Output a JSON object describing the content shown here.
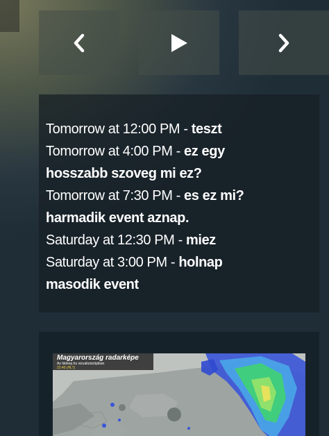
{
  "controls": {
    "prev_icon": "chevron-left-icon",
    "play_icon": "play-icon",
    "next_icon": "chevron-right-icon"
  },
  "events": [
    {
      "when": "Tomorrow at 12:00 PM",
      "separator": " - ",
      "title": "teszt"
    },
    {
      "when": "Tomorrow at 4:00 PM",
      "separator": " - ",
      "title": "ez egy hosszabb szoveg mi ez?"
    },
    {
      "when": "Tomorrow at 7:30 PM",
      "separator": " - ",
      "title": "es ez mi? harmadik event aznap."
    },
    {
      "when": "Saturday at 12:30 PM",
      "separator": " - ",
      "title": "miez"
    },
    {
      "when": "Saturday at 3:00 PM",
      "separator": " - ",
      "title": "holnap masodik event"
    }
  ],
  "radar": {
    "title": "Magyarország radarképe",
    "subtitle": "Az Idokep.hu vizualizációjában",
    "time": "22:40 (HLT)"
  },
  "colors": {
    "panel_bg": "#161e24",
    "button_bg": "#464e48",
    "text": "#ffffff",
    "radar_time": "#f2d640"
  }
}
